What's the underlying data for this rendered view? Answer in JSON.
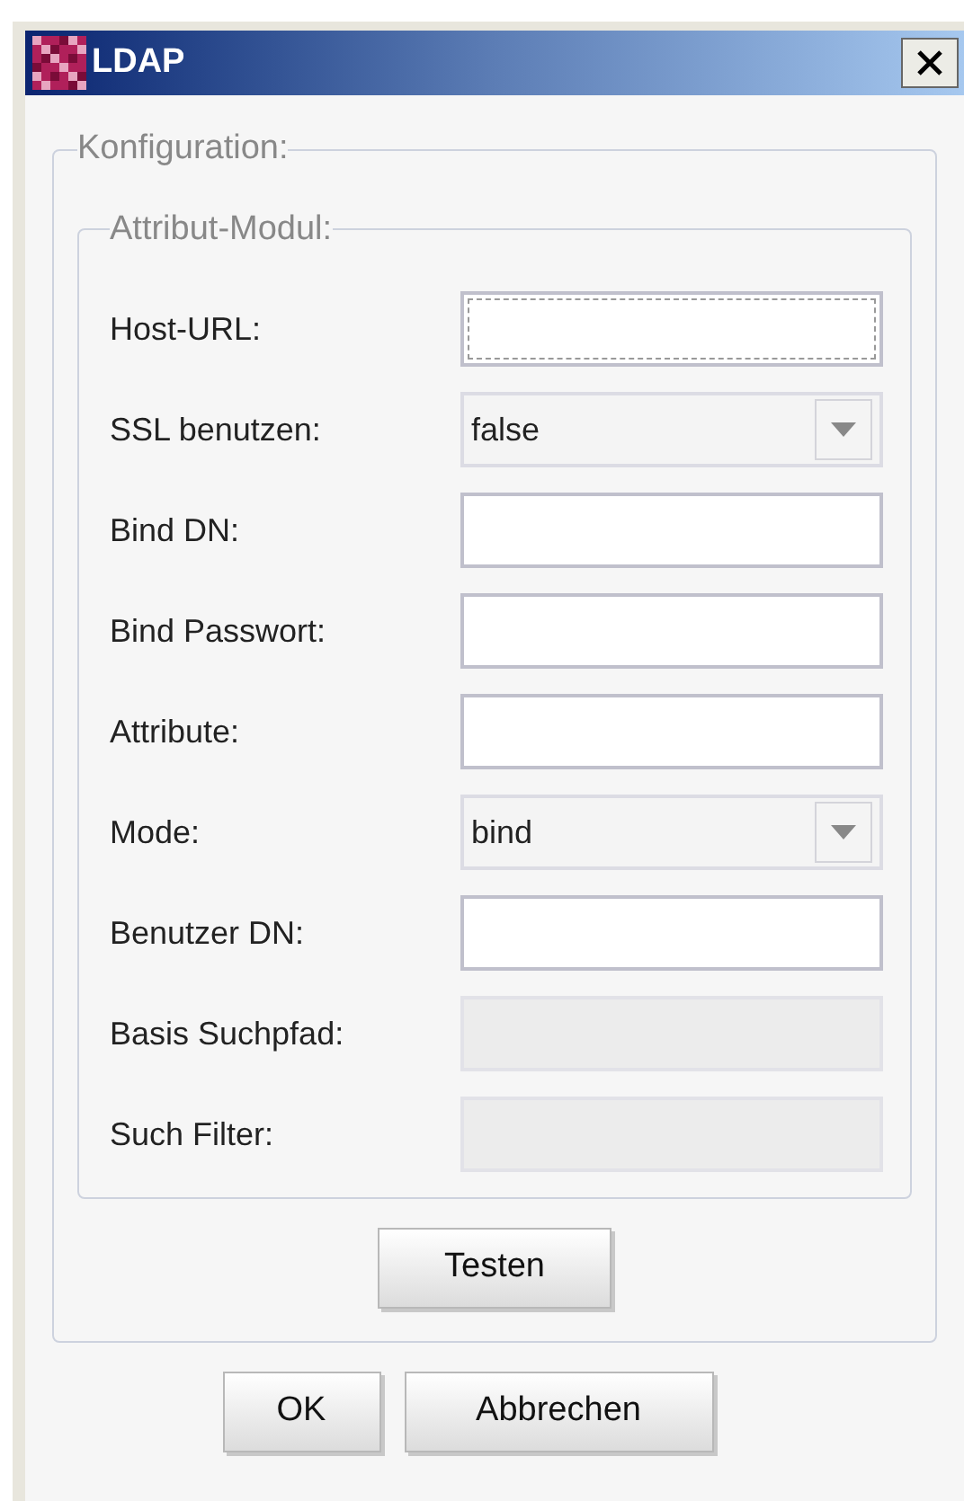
{
  "window": {
    "title": "LDAP"
  },
  "config_group": {
    "legend": "Konfiguration:"
  },
  "module_group": {
    "legend": "Attribut-Modul:"
  },
  "fields": [
    {
      "label": "Host-URL:",
      "kind": "text",
      "focused": true,
      "disabled": false
    },
    {
      "label": "SSL benutzen:",
      "kind": "select",
      "value": "false",
      "focused": false,
      "disabled": false
    },
    {
      "label": "Bind DN:",
      "kind": "text",
      "focused": false,
      "disabled": false
    },
    {
      "label": "Bind Passwort:",
      "kind": "text",
      "focused": false,
      "disabled": false
    },
    {
      "label": "Attribute:",
      "kind": "text",
      "focused": false,
      "disabled": false
    },
    {
      "label": "Mode:",
      "kind": "select",
      "value": "bind",
      "focused": false,
      "disabled": false
    },
    {
      "label": "Benutzer DN:",
      "kind": "text",
      "focused": false,
      "disabled": false
    },
    {
      "label": "Basis Suchpfad:",
      "kind": "text",
      "focused": false,
      "disabled": true
    },
    {
      "label": "Such Filter:",
      "kind": "text",
      "focused": false,
      "disabled": true
    }
  ],
  "test_button": "Testen",
  "buttons": [
    "OK",
    "Abbrechen"
  ]
}
